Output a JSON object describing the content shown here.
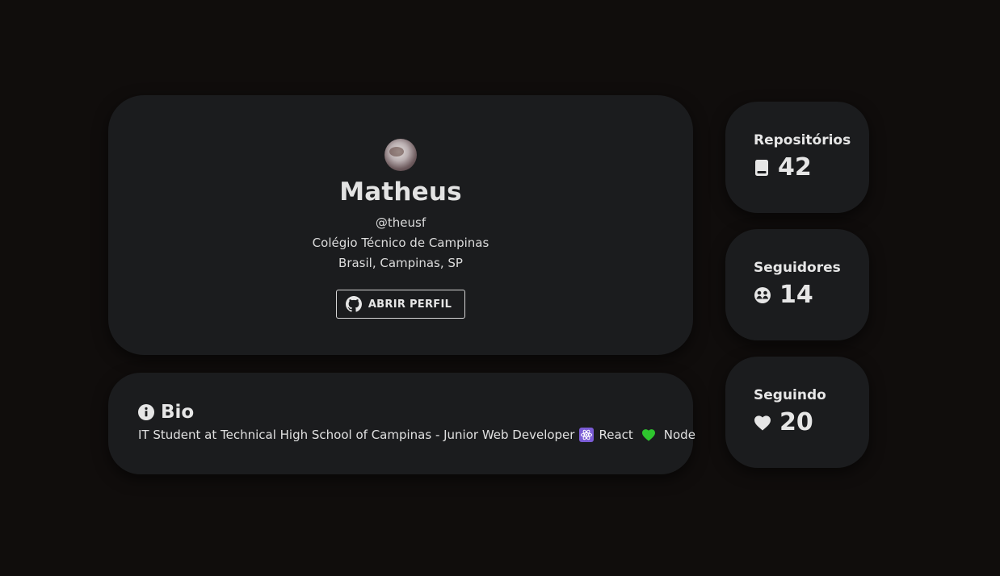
{
  "profile": {
    "name": "Matheus",
    "handle": "@theusf",
    "school": "Colégio Técnico de Campinas",
    "location": "Brasil, Campinas, SP",
    "open_profile_label": "ABRIR PERFIL",
    "github_icon": "github-icon"
  },
  "bio": {
    "title": "Bio",
    "text_part1": "IT Student at Technical High School of Campinas - Junior Web Developer",
    "react_label": "React",
    "node_label": "Node",
    "info_icon": "info-icon"
  },
  "stats": [
    {
      "title": "Repositórios",
      "value": "42",
      "icon": "book-icon"
    },
    {
      "title": "Seguidores",
      "value": "14",
      "icon": "users-icon"
    },
    {
      "title": "Seguindo",
      "value": "20",
      "icon": "heart-icon"
    }
  ],
  "colors": {
    "background": "#100d0c",
    "card": "#1b1c1e",
    "text": "#e6e6e6",
    "heart_green": "#2ec52e",
    "react_purple": "#7b5cd6"
  }
}
